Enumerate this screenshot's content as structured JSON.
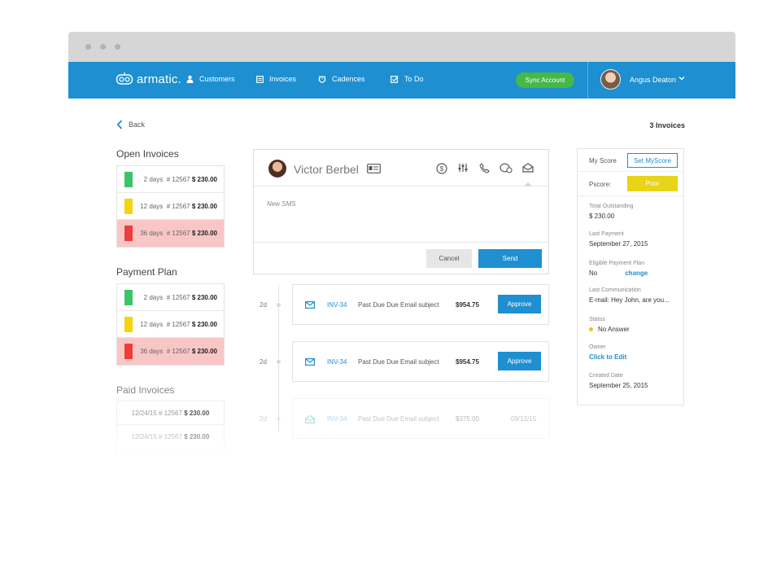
{
  "app": {
    "logo_text": "armatic."
  },
  "nav": {
    "items": [
      {
        "label": "Customers",
        "icon": "customers-icon"
      },
      {
        "label": "Invoices",
        "icon": "invoices-icon"
      },
      {
        "label": "Cadences",
        "icon": "cadences-icon"
      },
      {
        "label": "To Do",
        "icon": "todo-icon"
      }
    ],
    "sync_label": "Sync Account",
    "user_name": "Angus Deaton"
  },
  "page": {
    "back_label": "Back",
    "invoice_count": "3 Invoices"
  },
  "open_invoices": {
    "title": "Open Invoices",
    "rows": [
      {
        "days": "2 days",
        "number": "# 12567",
        "amount": "$ 230.00",
        "status": "green"
      },
      {
        "days": "12 days",
        "number": "# 12567",
        "amount": "$ 230.00",
        "status": "yellow"
      },
      {
        "days": "36 days",
        "number": "# 12567",
        "amount": "$ 230.00",
        "status": "red"
      }
    ]
  },
  "payment_plan": {
    "title": "Payment Plan",
    "rows": [
      {
        "days": "2 days",
        "number": "# 12567",
        "amount": "$ 230.00",
        "status": "green"
      },
      {
        "days": "12 days",
        "number": "# 12567",
        "amount": "$ 230.00",
        "status": "yellow"
      },
      {
        "days": "36 days",
        "number": "# 12567",
        "amount": "$ 230.00",
        "status": "red"
      }
    ]
  },
  "paid_invoices": {
    "title": "Paid Invoices",
    "rows": [
      {
        "date": "12/24/15",
        "number": "# 12567",
        "amount": "$ 230.00"
      },
      {
        "date": "12/24/15",
        "number": "# 12567",
        "amount": "$ 230.00"
      }
    ]
  },
  "contact": {
    "name": "Victor Berbel",
    "sms_placeholder": "New SMS",
    "cancel_label": "Cancel",
    "send_label": "Send"
  },
  "activities": [
    {
      "ago": "2d",
      "invoice": "INV-34",
      "subject": "Past Due Due Email subject",
      "amount": "$954.75",
      "action": "Approve"
    },
    {
      "ago": "2d",
      "invoice": "INV-34",
      "subject": "Past Due Due Email subject",
      "amount": "$954.75",
      "action": "Approve"
    },
    {
      "ago": "2d",
      "invoice": "INV-34",
      "subject": "Past Due Due Email subject",
      "amount": "$375.00",
      "date": "09/12/15"
    }
  ],
  "side": {
    "my_score_label": "My Score",
    "set_score_label": "Set MyScore",
    "pscore_label": "Pscore:",
    "pscore_value": "Poor",
    "total_outstanding_label": "Total Outstanding",
    "total_outstanding": "$ 230.00",
    "last_payment_label": "Last Payment",
    "last_payment": "September 27, 2015",
    "eligible_label": "Eligible Payment Plan",
    "eligible_value": "No",
    "eligible_change": "change",
    "last_comm_label": "Last Communication",
    "last_comm": "E-mail: Hey John, are you...",
    "status_label": "Status",
    "status_value": "No Answer",
    "owner_label": "Owner",
    "owner_value": "Click to Edit",
    "created_label": "Created Date",
    "created_value": "September 25, 2015"
  },
  "colors": {
    "brand": "#1e8fd0",
    "success": "#46b848",
    "status_green": "#3cc46a",
    "status_yellow": "#f2d50f",
    "status_red": "#ee3d3d",
    "poor": "#e8d418"
  }
}
